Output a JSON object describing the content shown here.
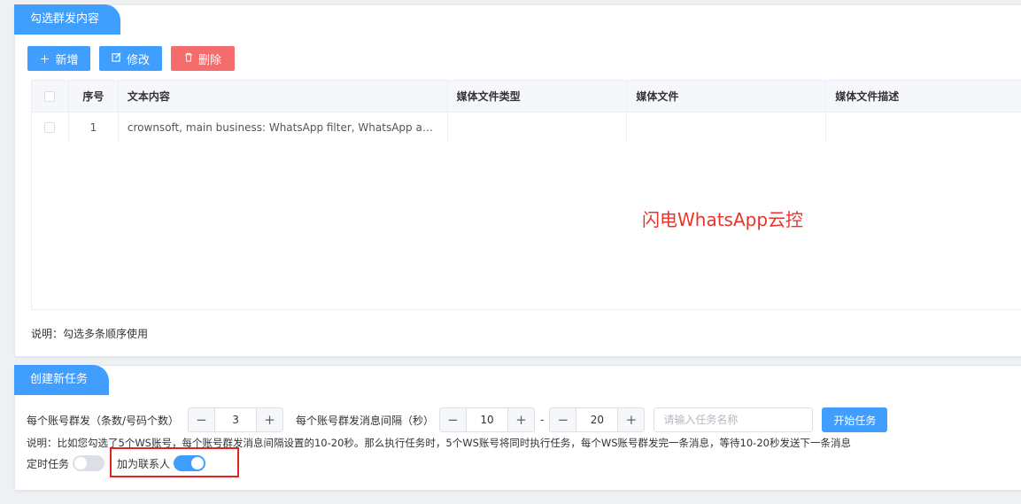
{
  "section1": {
    "title": "勾选群发内容",
    "buttons": {
      "add": "新增",
      "edit": "修改",
      "delete": "删除"
    },
    "icons": {
      "add": "plus-icon",
      "edit": "edit-icon",
      "delete": "trash-icon"
    },
    "table": {
      "headers": [
        "序号",
        "文本内容",
        "媒体文件类型",
        "媒体文件",
        "媒体文件描述"
      ],
      "rows": [
        {
          "no": "1",
          "text": "crownsoft, main business: WhatsApp filter, WhatsApp avata…",
          "type": "",
          "file": "",
          "desc": ""
        }
      ]
    },
    "watermark": "闪电WhatsApp云控",
    "note": "说明：勾选多条顺序使用"
  },
  "section2": {
    "title": "创建新任务",
    "per_account_label": "每个账号群发（条数/号码个数）",
    "per_account_value": "3",
    "interval_label": "每个账号群发消息间隔（秒）",
    "interval_min": "10",
    "interval_sep": "-",
    "interval_max": "20",
    "task_name_placeholder": "请输入任务名称",
    "start_button": "开始任务",
    "explain": "说明：比如您勾选了5个WS账号，每个账号群发消息间隔设置的10-20秒。那么执行任务时，5个WS账号将同时执行任务，每个WS账号群发完一条消息，等待10-20秒发送下一条消息",
    "scheduled_label": "定时任务",
    "scheduled_on": false,
    "add_contact_label": "加为联系人",
    "add_contact_on": true
  },
  "colors": {
    "primary": "#409eff",
    "danger": "#f56c6c",
    "highlight": "#e8201a"
  }
}
